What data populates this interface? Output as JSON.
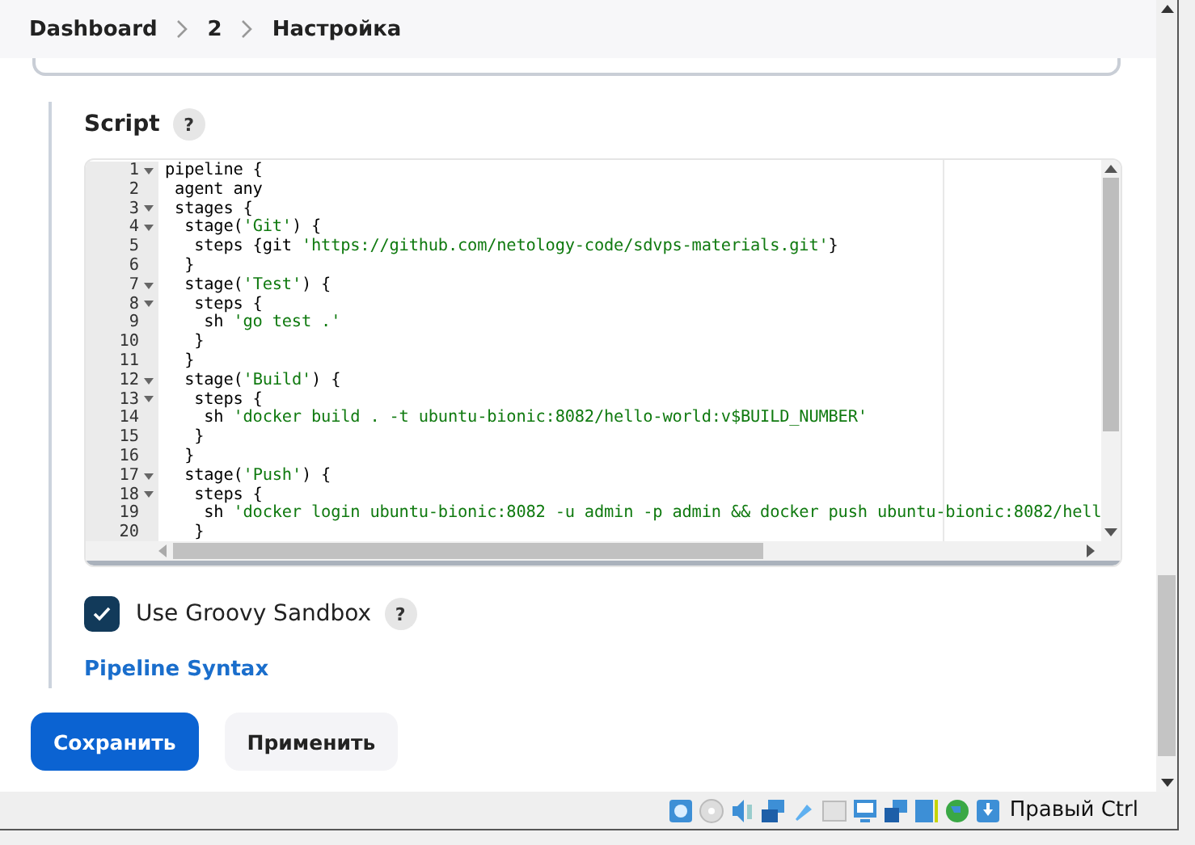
{
  "breadcrumb": [
    {
      "label": "Dashboard"
    },
    {
      "label": "2"
    },
    {
      "label": "Настройка"
    }
  ],
  "script": {
    "label": "Script",
    "help": "?",
    "lines": [
      {
        "number": "1",
        "foldable": true,
        "segments": [
          {
            "kind": "plain",
            "text": "pipeline {"
          }
        ]
      },
      {
        "number": "2",
        "foldable": false,
        "segments": [
          {
            "kind": "plain",
            "text": " agent any"
          }
        ]
      },
      {
        "number": "3",
        "foldable": true,
        "segments": [
          {
            "kind": "plain",
            "text": " stages {"
          }
        ]
      },
      {
        "number": "4",
        "foldable": true,
        "segments": [
          {
            "kind": "plain",
            "text": "  stage("
          },
          {
            "kind": "string",
            "text": "'Git'"
          },
          {
            "kind": "plain",
            "text": ") {"
          }
        ]
      },
      {
        "number": "5",
        "foldable": false,
        "segments": [
          {
            "kind": "plain",
            "text": "   steps {git "
          },
          {
            "kind": "string",
            "text": "'https://github.com/netology-code/sdvps-materials.git'"
          },
          {
            "kind": "plain",
            "text": "}"
          }
        ]
      },
      {
        "number": "6",
        "foldable": false,
        "segments": [
          {
            "kind": "plain",
            "text": "  }"
          }
        ]
      },
      {
        "number": "7",
        "foldable": true,
        "segments": [
          {
            "kind": "plain",
            "text": "  stage("
          },
          {
            "kind": "string",
            "text": "'Test'"
          },
          {
            "kind": "plain",
            "text": ") {"
          }
        ]
      },
      {
        "number": "8",
        "foldable": true,
        "segments": [
          {
            "kind": "plain",
            "text": "   steps {"
          }
        ]
      },
      {
        "number": "9",
        "foldable": false,
        "segments": [
          {
            "kind": "plain",
            "text": "    sh "
          },
          {
            "kind": "string",
            "text": "'go test .'"
          }
        ]
      },
      {
        "number": "10",
        "foldable": false,
        "segments": [
          {
            "kind": "plain",
            "text": "   }"
          }
        ]
      },
      {
        "number": "11",
        "foldable": false,
        "segments": [
          {
            "kind": "plain",
            "text": "  }"
          }
        ]
      },
      {
        "number": "12",
        "foldable": true,
        "segments": [
          {
            "kind": "plain",
            "text": "  stage("
          },
          {
            "kind": "string",
            "text": "'Build'"
          },
          {
            "kind": "plain",
            "text": ") {"
          }
        ]
      },
      {
        "number": "13",
        "foldable": true,
        "segments": [
          {
            "kind": "plain",
            "text": "   steps {"
          }
        ]
      },
      {
        "number": "14",
        "foldable": false,
        "segments": [
          {
            "kind": "plain",
            "text": "    sh "
          },
          {
            "kind": "string",
            "text": "'docker build . -t ubuntu-bionic:8082/hello-world:v$BUILD_NUMBER'"
          }
        ]
      },
      {
        "number": "15",
        "foldable": false,
        "segments": [
          {
            "kind": "plain",
            "text": "   }"
          }
        ]
      },
      {
        "number": "16",
        "foldable": false,
        "segments": [
          {
            "kind": "plain",
            "text": "  }"
          }
        ]
      },
      {
        "number": "17",
        "foldable": true,
        "segments": [
          {
            "kind": "plain",
            "text": "  stage("
          },
          {
            "kind": "string",
            "text": "'Push'"
          },
          {
            "kind": "plain",
            "text": ") {"
          }
        ]
      },
      {
        "number": "18",
        "foldable": true,
        "segments": [
          {
            "kind": "plain",
            "text": "   steps {"
          }
        ]
      },
      {
        "number": "19",
        "foldable": false,
        "segments": [
          {
            "kind": "plain",
            "text": "    sh "
          },
          {
            "kind": "string",
            "text": "'docker login ubuntu-bionic:8082 -u admin -p admin && docker push ubuntu-bionic:8082/hell"
          }
        ]
      },
      {
        "number": "20",
        "foldable": false,
        "segments": [
          {
            "kind": "plain",
            "text": "   }"
          }
        ]
      }
    ]
  },
  "sandbox": {
    "label": "Use Groovy Sandbox",
    "checked": true,
    "help": "?"
  },
  "syntax_link": "Pipeline Syntax",
  "buttons": [
    {
      "label": "Сохранить",
      "kind": "primary"
    },
    {
      "label": "Применить",
      "kind": "secondary"
    }
  ],
  "status_bar": {
    "host_key": "Правый Ctrl"
  }
}
